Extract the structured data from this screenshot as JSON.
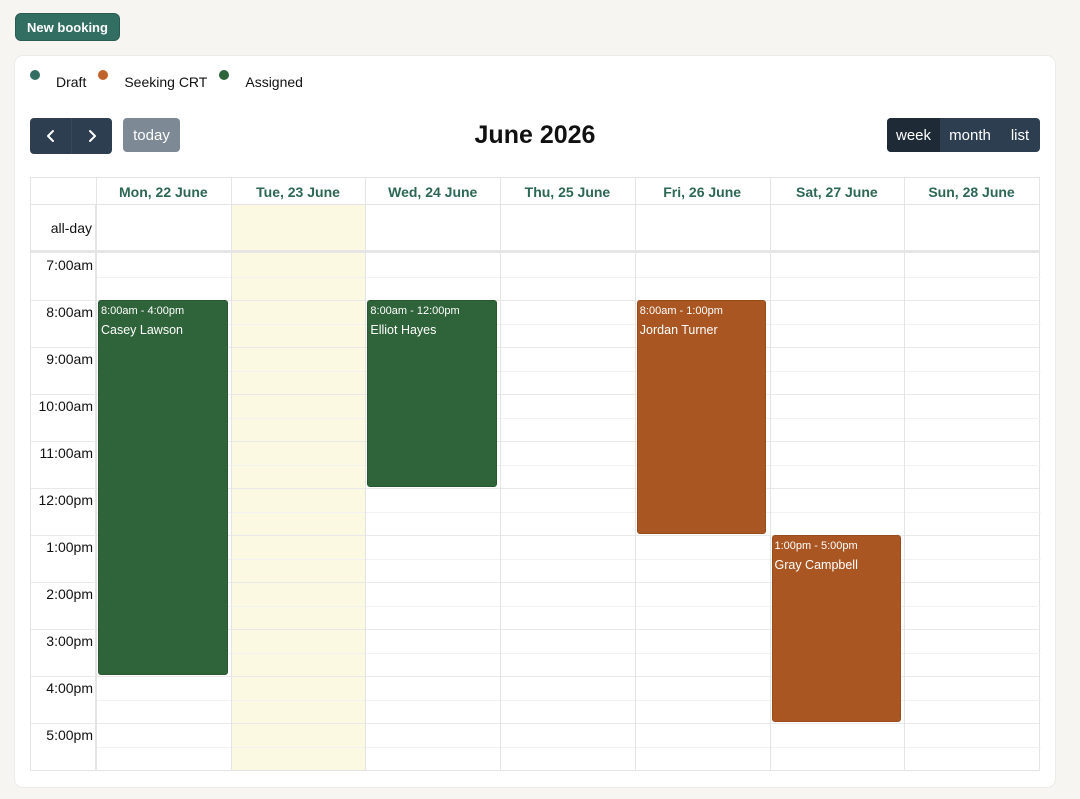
{
  "actions": {
    "new_booking_label": "New booking"
  },
  "legend": [
    {
      "label": "Draft",
      "color": "#336e63"
    },
    {
      "label": "Seeking CRT",
      "color": "#c0632a"
    },
    {
      "label": "Assigned",
      "color": "#2f6339"
    }
  ],
  "toolbar": {
    "prev_icon": "chevron-left-icon",
    "next_icon": "chevron-right-icon",
    "today_label": "today",
    "title": "June 2026",
    "views": [
      "week",
      "month",
      "list"
    ],
    "active_view": "week"
  },
  "calendar": {
    "allday_label": "all-day",
    "days": [
      "Mon, 22 June",
      "Tue, 23 June",
      "Wed, 24 June",
      "Thu, 25 June",
      "Fri, 26 June",
      "Sat, 27 June",
      "Sun, 28 June"
    ],
    "today_index": 1,
    "hours": [
      "7:00am",
      "8:00am",
      "9:00am",
      "10:00am",
      "11:00am",
      "12:00pm",
      "1:00pm",
      "2:00pm",
      "3:00pm",
      "4:00pm",
      "5:00pm"
    ],
    "events": [
      {
        "time": "8:00am - 4:00pm",
        "title": "Casey Lawson",
        "status": "assigned",
        "day": "Mon, 22 June",
        "start": "8:00am",
        "end": "4:00pm"
      },
      {
        "time": "8:00am - 12:00pm",
        "title": "Elliot Hayes",
        "status": "assigned",
        "day": "Wed, 24 June",
        "start": "8:00am",
        "end": "12:00pm"
      },
      {
        "time": "8:00am - 1:00pm",
        "title": "Jordan Turner",
        "status": "seeking",
        "day": "Fri, 26 June",
        "start": "8:00am",
        "end": "1:00pm"
      },
      {
        "time": "1:00pm - 5:00pm",
        "title": "Gray Campbell",
        "status": "seeking",
        "day": "Sat, 27 June",
        "start": "1:00pm",
        "end": "5:00pm"
      }
    ]
  }
}
